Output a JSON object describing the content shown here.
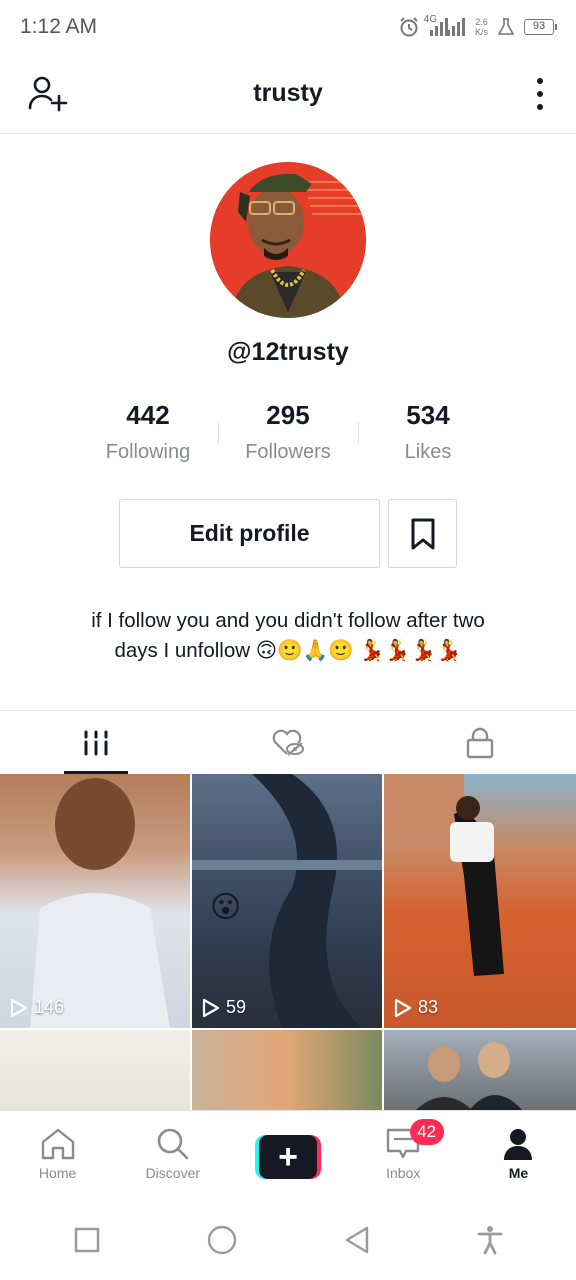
{
  "status_bar": {
    "time": "1:12 AM",
    "network_type": "4G",
    "speed_value": "2.6",
    "speed_unit": "K/s",
    "battery": "93",
    "icons": [
      "alarm-icon",
      "signal-icon",
      "lab-icon",
      "battery-icon"
    ]
  },
  "header": {
    "title": "trusty",
    "icons": [
      "add-user-icon",
      "more-vertical-icon"
    ]
  },
  "profile": {
    "username": "@12trusty",
    "stats": [
      {
        "value": "442",
        "label": "Following"
      },
      {
        "value": "295",
        "label": "Followers"
      },
      {
        "value": "534",
        "label": "Likes"
      }
    ],
    "edit_button": "Edit profile",
    "bio_line1": "if I follow you and you didn't follow after two",
    "bio_line2": "days I unfollow 🙃🙂🙏🙂 💃💃💃💃"
  },
  "tabs": [
    {
      "name": "videos",
      "icon": "grid-icon",
      "active": true
    },
    {
      "name": "liked",
      "icon": "liked-hidden-icon",
      "active": false
    },
    {
      "name": "private",
      "icon": "lock-icon",
      "active": false
    }
  ],
  "videos": [
    {
      "views": "146"
    },
    {
      "views": "59",
      "sticker": "😮"
    },
    {
      "views": "83"
    }
  ],
  "bottom_nav": {
    "home": "Home",
    "discover": "Discover",
    "create": "+",
    "inbox": "Inbox",
    "inbox_badge": "42",
    "me": "Me"
  },
  "colors": {
    "accent": "#fe2c55",
    "cyan": "#25f4ee",
    "text": "#161823",
    "muted": "#8a8b91"
  }
}
